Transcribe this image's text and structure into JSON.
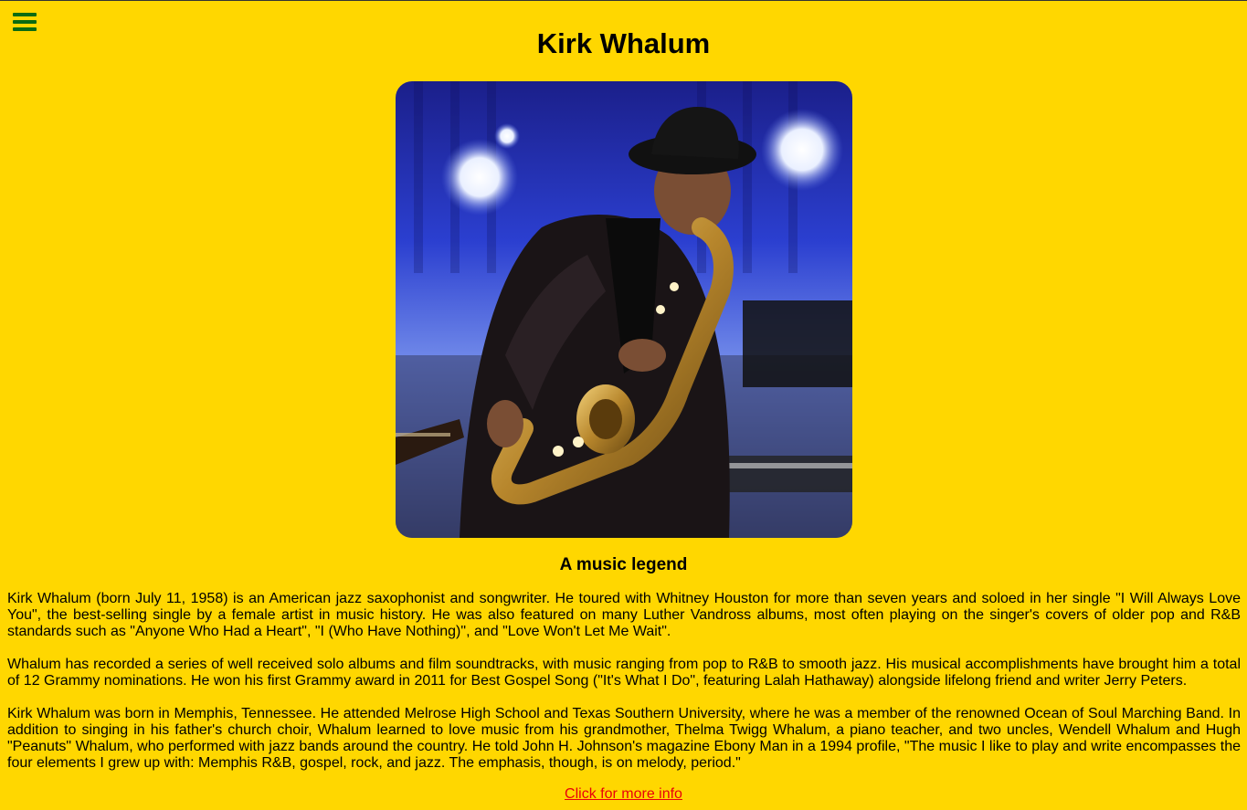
{
  "page": {
    "title": "Kirk Whalum",
    "photo_subject": "saxophonist-performing-on-stage",
    "subtitle": "A music legend",
    "more_link_label": "Click for more info"
  },
  "menu": {
    "icon": "hamburger-menu-icon"
  },
  "bio": {
    "paragraphs": [
      "Kirk Whalum (born July 11, 1958) is an American jazz saxophonist and songwriter. He toured with Whitney Houston for more than seven years and soloed in her single \"I Will Always Love You\", the best-selling single by a female artist in music history. He was also featured on many Luther Vandross albums, most often playing on the singer's covers of older pop and R&B standards such as \"Anyone Who Had a Heart\", \"I (Who Have Nothing)\", and \"Love Won't Let Me Wait\".",
      "Whalum has recorded a series of well received solo albums and film soundtracks, with music ranging from pop to R&B to smooth jazz. His musical accomplishments have brought him a total of 12 Grammy nominations. He won his first Grammy award in 2011 for Best Gospel Song (\"It's What I Do\", featuring Lalah Hathaway) alongside lifelong friend and writer Jerry Peters.",
      "Kirk Whalum was born in Memphis, Tennessee. He attended Melrose High School and Texas Southern University, where he was a member of the renowned Ocean of Soul Marching Band. In addition to singing in his father's church choir, Whalum learned to love music from his grandmother, Thelma Twigg Whalum, a piano teacher, and two uncles, Wendell Whalum and Hugh \"Peanuts\" Whalum, who performed with jazz bands around the country. He told John H. Johnson's magazine Ebony Man in a 1994 profile, \"The music I like to play and write encompasses the four elements I grew up with: Memphis R&B, gospel, rock, and jazz. The emphasis, though, is on melody, period.\""
    ]
  },
  "colors": {
    "background": "#FFD700",
    "menu_icon": "#0a6b12",
    "link": "#e8000b"
  }
}
